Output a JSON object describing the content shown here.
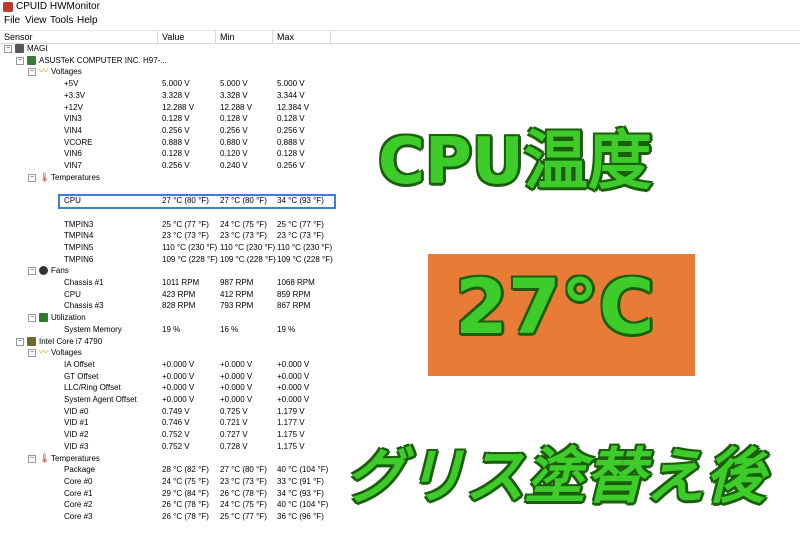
{
  "window": {
    "title": "CPUID HWMonitor"
  },
  "menu": [
    "File",
    "View",
    "Tools",
    "Help"
  ],
  "columns": {
    "sensor": "Sensor",
    "value": "Value",
    "min": "Min",
    "max": "Max"
  },
  "rows": [
    {
      "label": "MAGI",
      "value": "",
      "min": "",
      "max": "",
      "icon": "pc-icon"
    },
    {
      "label": "ASUSTeK COMPUTER INC. H97-...",
      "value": "",
      "min": "",
      "max": "",
      "icon": "motherboard-icon"
    },
    {
      "label": "Voltages",
      "value": "",
      "min": "",
      "max": "",
      "icon": "voltage-icon"
    },
    {
      "label": "+5V",
      "value": "5.000 V",
      "min": "5.000 V",
      "max": "5.000 V"
    },
    {
      "label": "+3.3V",
      "value": "3.328 V",
      "min": "3.328 V",
      "max": "3.344 V"
    },
    {
      "label": "+12V",
      "value": "12.288 V",
      "min": "12.288 V",
      "max": "12.384 V"
    },
    {
      "label": "VIN3",
      "value": "0.128 V",
      "min": "0.128 V",
      "max": "0.128 V"
    },
    {
      "label": "VIN4",
      "value": "0.256 V",
      "min": "0.256 V",
      "max": "0.256 V"
    },
    {
      "label": "VCORE",
      "value": "0.888 V",
      "min": "0.880 V",
      "max": "0.888 V"
    },
    {
      "label": "VIN6",
      "value": "0.128 V",
      "min": "0.120 V",
      "max": "0.128 V"
    },
    {
      "label": "VIN7",
      "value": "0.256 V",
      "min": "0.240 V",
      "max": "0.256 V"
    },
    {
      "label": "Temperatures",
      "value": "",
      "min": "",
      "max": "",
      "icon": "thermometer-icon"
    },
    {
      "label": "",
      "value": "",
      "min": "",
      "max": ""
    },
    {
      "label": "CPU",
      "value": "27 °C  (80 °F)",
      "min": "27 °C  (80 °F)",
      "max": "34 °C  (93 °F)"
    },
    {
      "label": "",
      "value": "",
      "min": "",
      "max": ""
    },
    {
      "label": "TMPIN3",
      "value": "25 °C  (77 °F)",
      "min": "24 °C  (75 °F)",
      "max": "25 °C  (77 °F)"
    },
    {
      "label": "TMPIN4",
      "value": "23 °C  (73 °F)",
      "min": "23 °C  (73 °F)",
      "max": "23 °C  (73 °F)"
    },
    {
      "label": "TMPIN5",
      "value": "110 °C  (230 °F)",
      "min": "110 °C  (230 °F)",
      "max": "110 °C  (230 °F)"
    },
    {
      "label": "TMPIN6",
      "value": "109 °C  (228 °F)",
      "min": "109 °C  (228 °F)",
      "max": "109 °C  (228 °F)"
    },
    {
      "label": "Fans",
      "value": "",
      "min": "",
      "max": "",
      "icon": "fan-icon"
    },
    {
      "label": "Chassis #1",
      "value": "1011 RPM",
      "min": "987 RPM",
      "max": "1068 RPM"
    },
    {
      "label": "CPU",
      "value": "423 RPM",
      "min": "412 RPM",
      "max": "859 RPM"
    },
    {
      "label": "Chassis #3",
      "value": "828 RPM",
      "min": "793 RPM",
      "max": "867 RPM"
    },
    {
      "label": "Utilization",
      "value": "",
      "min": "",
      "max": "",
      "icon": "utilization-icon"
    },
    {
      "label": "System Memory",
      "value": "19 %",
      "min": "16 %",
      "max": "19 %"
    },
    {
      "label": "Intel Core i7 4790",
      "value": "",
      "min": "",
      "max": "",
      "icon": "cpu-chip-icon"
    },
    {
      "label": "Voltages",
      "value": "",
      "min": "",
      "max": "",
      "icon": "voltage-icon"
    },
    {
      "label": "IA Offset",
      "value": "+0.000 V",
      "min": "+0.000 V",
      "max": "+0.000 V"
    },
    {
      "label": "GT Offset",
      "value": "+0.000 V",
      "min": "+0.000 V",
      "max": "+0.000 V"
    },
    {
      "label": "LLC/Ring Offset",
      "value": "+0.000 V",
      "min": "+0.000 V",
      "max": "+0.000 V"
    },
    {
      "label": "System Agent Offset",
      "value": "+0.000 V",
      "min": "+0.000 V",
      "max": "+0.000 V"
    },
    {
      "label": "VID #0",
      "value": "0.749 V",
      "min": "0.725 V",
      "max": "1.179 V"
    },
    {
      "label": "VID #1",
      "value": "0.746 V",
      "min": "0.721 V",
      "max": "1.177 V"
    },
    {
      "label": "VID #2",
      "value": "0.752 V",
      "min": "0.727 V",
      "max": "1.175 V"
    },
    {
      "label": "VID #3",
      "value": "0.752 V",
      "min": "0.728 V",
      "max": "1.175 V"
    },
    {
      "label": "Temperatures",
      "value": "",
      "min": "",
      "max": "",
      "icon": "thermometer-icon"
    },
    {
      "label": "Package",
      "value": "28 °C  (82 °F)",
      "min": "27 °C  (80 °F)",
      "max": "40 °C  (104 °F)"
    },
    {
      "label": "Core #0",
      "value": "24 °C  (75 °F)",
      "min": "23 °C  (73 °F)",
      "max": "33 °C  (91 °F)"
    },
    {
      "label": "Core #1",
      "value": "29 °C  (84 °F)",
      "min": "26 °C  (78 °F)",
      "max": "34 °C  (93 °F)"
    },
    {
      "label": "Core #2",
      "value": "26 °C  (78 °F)",
      "min": "24 °C  (75 °F)",
      "max": "40 °C  (104 °F)"
    },
    {
      "label": "Core #3",
      "value": "26 °C  (78 °F)",
      "min": "25 °C  (77 °F)",
      "max": "36 °C  (96 °F)"
    }
  ],
  "overlay": {
    "headline": "CPU温度",
    "temperature": "27°C",
    "caption": "グリス塗替え後",
    "accent_color": "#3ecc2a",
    "badge_color": "#e87b36",
    "highlight_color": "#3c7fd6"
  }
}
